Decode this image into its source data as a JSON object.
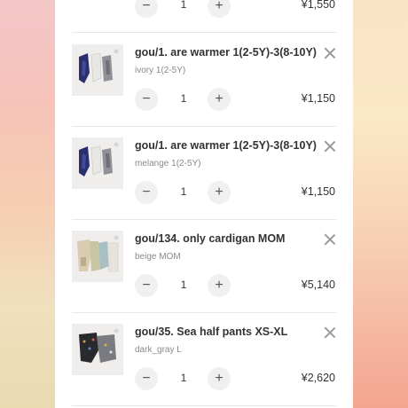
{
  "currency_symbol": "¥",
  "cart": {
    "items": [
      {
        "title": "",
        "variant": "",
        "quantity": "1",
        "price": "¥1,550",
        "decrease_label": "−",
        "increase_label": "+"
      },
      {
        "title": "gou/1. are warmer 1(2-5Y)-3(8-10Y)",
        "variant": "ivory 1(2-5Y)",
        "quantity": "1",
        "price": "¥1,150",
        "decrease_label": "−",
        "increase_label": "+"
      },
      {
        "title": "gou/1. are warmer 1(2-5Y)-3(8-10Y)",
        "variant": "melange 1(2-5Y)",
        "quantity": "1",
        "price": "¥1,150",
        "decrease_label": "−",
        "increase_label": "+"
      },
      {
        "title": "gou/134. only cardigan MOM",
        "variant": "beige MOM",
        "quantity": "1",
        "price": "¥5,140",
        "decrease_label": "−",
        "increase_label": "+"
      },
      {
        "title": "gou/35. Sea half pants XS-XL",
        "variant": "dark_gray L",
        "quantity": "1",
        "price": "¥2,620",
        "decrease_label": "−",
        "increase_label": "+"
      }
    ]
  },
  "icons": {
    "remove": "close-icon",
    "decrease": "minus-icon",
    "increase": "plus-icon"
  },
  "colors": {
    "panel_bg": "#ffffff",
    "button_bg": "#f0f0f0",
    "text": "#333333",
    "muted_text": "#8a8a8a"
  }
}
